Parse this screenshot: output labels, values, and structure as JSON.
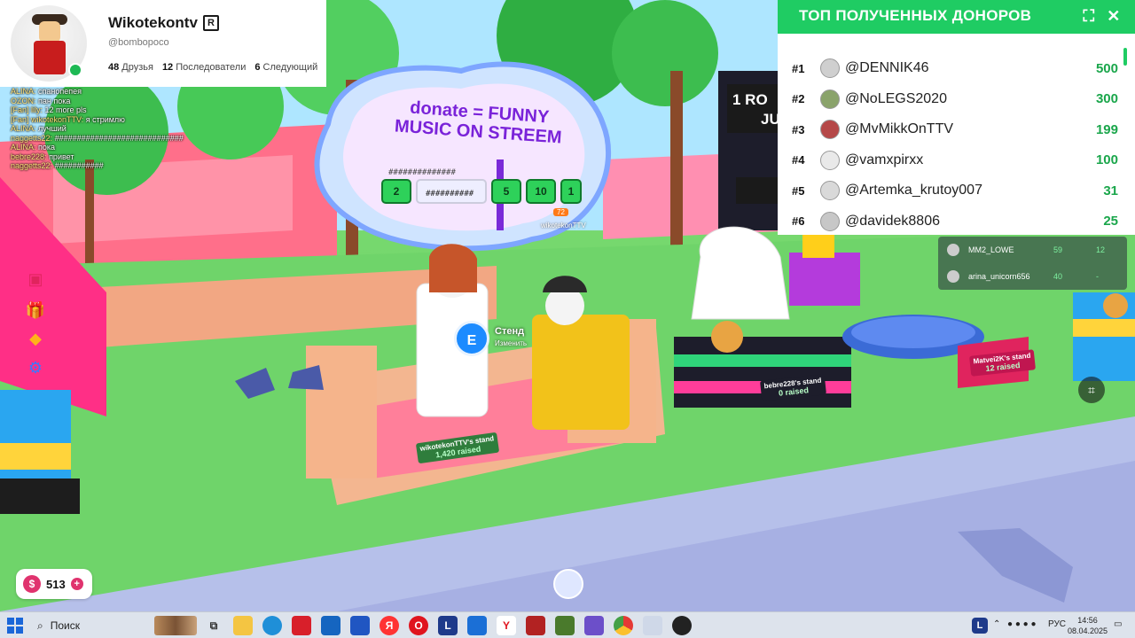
{
  "profile": {
    "name": "Wikotekontv",
    "handle": "@bomboроco",
    "friends_count": "48",
    "friends_label": "Друзья",
    "followers_count": "12",
    "followers_label": "Последователи",
    "following_count": "6",
    "following_label": "Следующий"
  },
  "chat": [
    {
      "name": "ALINA:",
      "text": "спанопепея"
    },
    {
      "name": "OZON:",
      "text": "пан пока"
    },
    {
      "name": "[Fan] lily:",
      "text": "12 more pls"
    },
    {
      "name": "[Fan] wikotekonTTV:",
      "text": "я стримлю"
    },
    {
      "name": "ALINA:",
      "text": "лучший"
    },
    {
      "name": "naggetts22:",
      "text": "#############################"
    },
    {
      "name": "ALINA:",
      "text": "пока"
    },
    {
      "name": "bebre228:",
      "text": "привет"
    },
    {
      "name": "naggetts22:",
      "text": "###########"
    }
  ],
  "donors_panel": {
    "title": "ТОП ПОЛУЧЕННЫХ ДОНОРОВ",
    "donors": [
      {
        "rank": "#1",
        "name": "@DENNIK46",
        "amount": "500"
      },
      {
        "rank": "#2",
        "name": "@NoLEGS2020",
        "amount": "300"
      },
      {
        "rank": "#3",
        "name": "@MvMikkOnTTV",
        "amount": "199"
      },
      {
        "rank": "#4",
        "name": "@vamxpirxx",
        "amount": "100"
      },
      {
        "rank": "#5",
        "name": "@Artemka_krutoy007",
        "amount": "31"
      },
      {
        "rank": "#6",
        "name": "@davidek8806",
        "amount": "25"
      }
    ]
  },
  "mini_overlay": [
    {
      "name": "MM2_LOWE",
      "a": "59",
      "b": "12"
    },
    {
      "name": "arina_unicorn656",
      "a": "40",
      "b": "-"
    }
  ],
  "sign": {
    "line1": "donate = FUNNY",
    "line2": "MUSIC ON STREEM",
    "hash1": "##############",
    "hash2": "##########",
    "buttons": [
      "2",
      "",
      "",
      "5",
      "10",
      "1"
    ],
    "owner": "wikotekonTTV",
    "badge": "72"
  },
  "prompt": {
    "key": "E",
    "title": "Стенд",
    "subtitle": "Изменить"
  },
  "stands": [
    {
      "title": "wikotekonTTV's stand",
      "raised": "1,420 raised"
    },
    {
      "title": "bebre228's stand",
      "raised": "0 raised"
    },
    {
      "title": "Matvei2K's stand",
      "raised": "12 raised"
    }
  ],
  "booth_sign": {
    "line1": "1 RO",
    "line2": "JU"
  },
  "robux": {
    "value": "513"
  },
  "taskbar": {
    "search_label": "Поиск",
    "lang": "РУС",
    "time": "14:56",
    "date": "08.04.2025",
    "app_l": "L"
  },
  "colors": {
    "accent_green": "#1fcc63",
    "robux": "#e0336e",
    "sign_text": "#7a23d9"
  }
}
